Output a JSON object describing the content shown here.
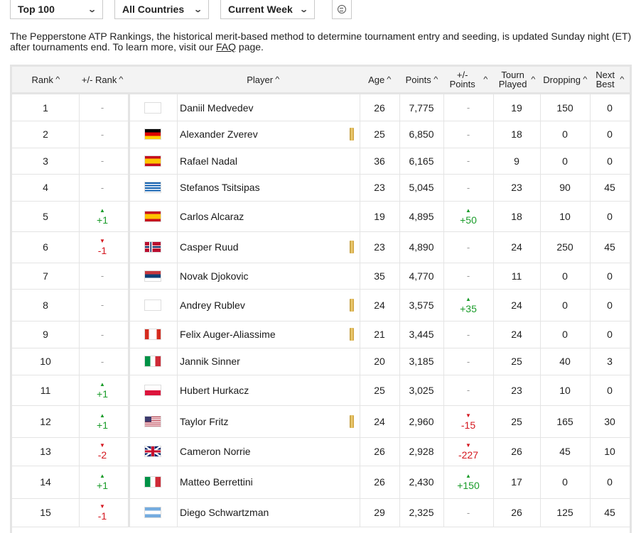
{
  "filters": {
    "rank_range": "Top 100",
    "country": "All Countries",
    "week": "Current Week"
  },
  "description": {
    "text": "The Pepperstone ATP Rankings, the historical merit-based method to determine tournament entry and seeding, is updated Sunday night (ET) after tournaments end. To learn more, visit our ",
    "link": "FAQ",
    "suffix": " page."
  },
  "columns": {
    "rank": "Rank",
    "rank_move": "+/- Rank",
    "player": "Player",
    "age": "Age",
    "points": "Points",
    "points_move_line1": "+/-",
    "points_move_line2": "Points",
    "tourn_line1": "Tourn",
    "tourn_line2": "Played",
    "dropping": "Dropping",
    "next_line1": "Next",
    "next_line2": "Best"
  },
  "colors": {
    "up": "#1a9c2a",
    "down": "#d4161e",
    "border": "#e4e4e4",
    "header_bg": "#f3f3f3"
  },
  "rows": [
    {
      "rank": "1",
      "move": "-",
      "dir": "none",
      "country": "none",
      "player": "Daniil Medvedev",
      "badge": false,
      "age": "26",
      "points": "7,775",
      "pmove": "-",
      "pdir": "none",
      "played": "19",
      "dropping": "150",
      "next": "0"
    },
    {
      "rank": "2",
      "move": "-",
      "dir": "none",
      "country": "GER",
      "player": "Alexander Zverev",
      "badge": true,
      "age": "25",
      "points": "6,850",
      "pmove": "-",
      "pdir": "none",
      "played": "18",
      "dropping": "0",
      "next": "0"
    },
    {
      "rank": "3",
      "move": "-",
      "dir": "none",
      "country": "ESP",
      "player": "Rafael Nadal",
      "badge": false,
      "age": "36",
      "points": "6,165",
      "pmove": "-",
      "pdir": "none",
      "played": "9",
      "dropping": "0",
      "next": "0"
    },
    {
      "rank": "4",
      "move": "-",
      "dir": "none",
      "country": "GRE",
      "player": "Stefanos Tsitsipas",
      "badge": false,
      "age": "23",
      "points": "5,045",
      "pmove": "-",
      "pdir": "none",
      "played": "23",
      "dropping": "90",
      "next": "45"
    },
    {
      "rank": "5",
      "move": "+1",
      "dir": "up",
      "country": "ESP",
      "player": "Carlos Alcaraz",
      "badge": false,
      "age": "19",
      "points": "4,895",
      "pmove": "+50",
      "pdir": "up",
      "played": "18",
      "dropping": "10",
      "next": "0"
    },
    {
      "rank": "6",
      "move": "-1",
      "dir": "down",
      "country": "NOR",
      "player": "Casper Ruud",
      "badge": true,
      "age": "23",
      "points": "4,890",
      "pmove": "-",
      "pdir": "none",
      "played": "24",
      "dropping": "250",
      "next": "45"
    },
    {
      "rank": "7",
      "move": "-",
      "dir": "none",
      "country": "SRB",
      "player": "Novak Djokovic",
      "badge": false,
      "age": "35",
      "points": "4,770",
      "pmove": "-",
      "pdir": "none",
      "played": "11",
      "dropping": "0",
      "next": "0"
    },
    {
      "rank": "8",
      "move": "-",
      "dir": "none",
      "country": "none",
      "player": "Andrey Rublev",
      "badge": true,
      "age": "24",
      "points": "3,575",
      "pmove": "+35",
      "pdir": "up",
      "played": "24",
      "dropping": "0",
      "next": "0"
    },
    {
      "rank": "9",
      "move": "-",
      "dir": "none",
      "country": "CAN",
      "player": "Felix Auger-Aliassime",
      "badge": true,
      "age": "21",
      "points": "3,445",
      "pmove": "-",
      "pdir": "none",
      "played": "24",
      "dropping": "0",
      "next": "0"
    },
    {
      "rank": "10",
      "move": "-",
      "dir": "none",
      "country": "ITA",
      "player": "Jannik Sinner",
      "badge": false,
      "age": "20",
      "points": "3,185",
      "pmove": "-",
      "pdir": "none",
      "played": "25",
      "dropping": "40",
      "next": "3"
    },
    {
      "rank": "11",
      "move": "+1",
      "dir": "up",
      "country": "POL",
      "player": "Hubert Hurkacz",
      "badge": false,
      "age": "25",
      "points": "3,025",
      "pmove": "-",
      "pdir": "none",
      "played": "23",
      "dropping": "10",
      "next": "0"
    },
    {
      "rank": "12",
      "move": "+1",
      "dir": "up",
      "country": "USA",
      "player": "Taylor Fritz",
      "badge": true,
      "age": "24",
      "points": "2,960",
      "pmove": "-15",
      "pdir": "down",
      "played": "25",
      "dropping": "165",
      "next": "30"
    },
    {
      "rank": "13",
      "move": "-2",
      "dir": "down",
      "country": "GBR",
      "player": "Cameron Norrie",
      "badge": false,
      "age": "26",
      "points": "2,928",
      "pmove": "-227",
      "pdir": "down",
      "played": "26",
      "dropping": "45",
      "next": "10"
    },
    {
      "rank": "14",
      "move": "+1",
      "dir": "up",
      "country": "ITA",
      "player": "Matteo Berrettini",
      "badge": false,
      "age": "26",
      "points": "2,430",
      "pmove": "+150",
      "pdir": "up",
      "played": "17",
      "dropping": "0",
      "next": "0"
    },
    {
      "rank": "15",
      "move": "-1",
      "dir": "down",
      "country": "ARG",
      "player": "Diego Schwartzman",
      "badge": false,
      "age": "29",
      "points": "2,325",
      "pmove": "-",
      "pdir": "none",
      "played": "26",
      "dropping": "125",
      "next": "45"
    }
  ]
}
